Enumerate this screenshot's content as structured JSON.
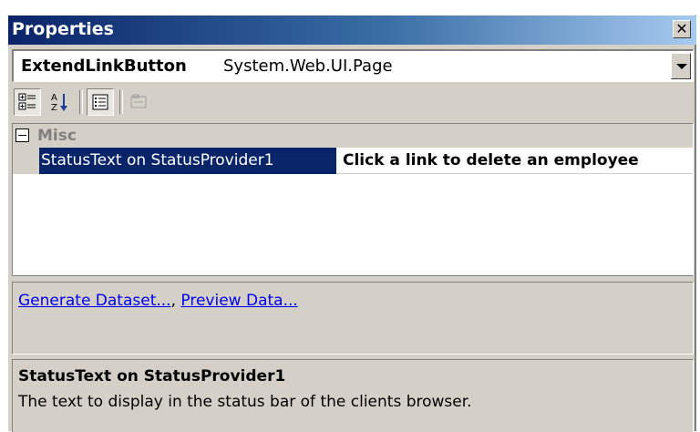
{
  "window": {
    "title": "Properties",
    "close_glyph": "✕"
  },
  "object_selector": {
    "name": "ExtendLinkButton",
    "type": "System.Web.UI.Page"
  },
  "toolbar": {
    "buttons": [
      {
        "icon": "categorized-icon",
        "pressed": true
      },
      {
        "icon": "alphabetical-icon",
        "pressed": false
      },
      {
        "icon": "properties-icon",
        "pressed": true
      },
      {
        "icon": "property-pages-icon",
        "pressed": false,
        "disabled": true
      }
    ]
  },
  "grid": {
    "category": "Misc",
    "properties": [
      {
        "name": "StatusText on StatusProvider1",
        "value": "Click a link to delete an employee",
        "selected": true
      }
    ]
  },
  "commands": {
    "items": [
      "Generate Dataset...",
      "Preview Data..."
    ],
    "separator": ", "
  },
  "description": {
    "title": "StatusText on StatusProvider1",
    "text": "The text to display in the status bar of the clients browser."
  }
}
